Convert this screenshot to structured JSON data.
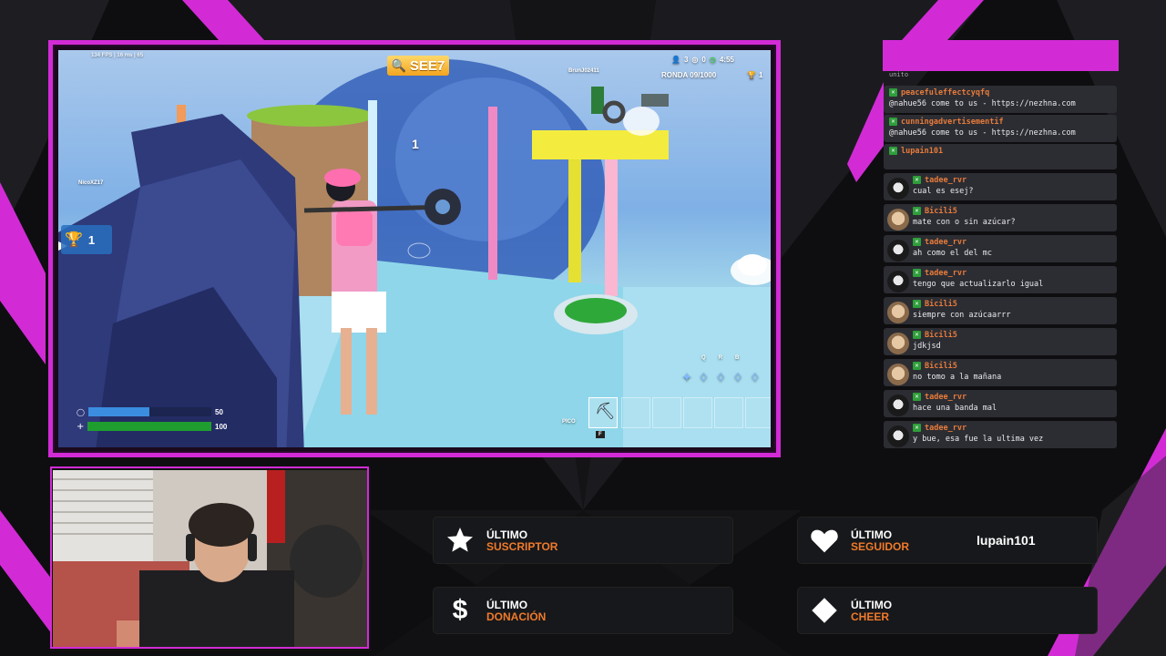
{
  "theme": {
    "accent": "#d22bd6",
    "label_accent": "#f07a2a",
    "panel_bg": "#17181b"
  },
  "game": {
    "hud_topleft": "134 FPS  |  16 ms  |  65",
    "player_search": "SEE7",
    "team_count": "3",
    "elims": "0",
    "timer": "4:55",
    "round_label": "RONDA 09/1000",
    "players_left": "1",
    "opponent_name": "BrunJ02411",
    "enemy_name": "NicoXZ17",
    "floating_number": "1",
    "trophy_count": "1",
    "shield_value": "50",
    "health_value": "100",
    "shield_pct": 0.5,
    "health_pct": 1.0,
    "weapon_label": "PICO",
    "weapon_key": "F",
    "build_keys": [
      "Q",
      "R",
      "B"
    ]
  },
  "chat": {
    "partial_top": "unito",
    "messages": [
      {
        "user": "peacefuleffectcyqfq",
        "text": "@nahue56 come to us - https://nezhna.com",
        "avatar": false
      },
      {
        "user": "cunningadvertisementif",
        "text": "@nahue56 come to us - https://nezhna.com",
        "avatar": false
      },
      {
        "user": "lupain101",
        "text": "",
        "avatar": false
      },
      {
        "user": "tadee_rvr",
        "text": "cual es esej?",
        "avatar": "dark"
      },
      {
        "user": "Bicili5",
        "text": "mate con o sin azúcar?",
        "avatar": "dog"
      },
      {
        "user": "tadee_rvr",
        "text": "ah como el del mc",
        "avatar": "dark"
      },
      {
        "user": "tadee_rvr",
        "text": "tengo que actualizarlo igual",
        "avatar": "dark"
      },
      {
        "user": "Bicili5",
        "text": "siempre con azúcaarrr",
        "avatar": "dog"
      },
      {
        "user": "Bicili5",
        "text": "jdkjsd",
        "avatar": "dog"
      },
      {
        "user": "Bicili5",
        "text": "no tomo a la mañana",
        "avatar": "dog"
      },
      {
        "user": "tadee_rvr",
        "text": "hace una banda mal",
        "avatar": "dark"
      },
      {
        "user": "tadee_rvr",
        "text": "y bue, esa fue la ultima vez",
        "avatar": "dark"
      }
    ]
  },
  "alerts": {
    "subscriber": {
      "title": "ÚLTIMO",
      "sub": "SUSCRIPTOR",
      "value": "",
      "icon": "star-icon"
    },
    "follower": {
      "title": "ÚLTIMO",
      "sub": "SEGUIDOR",
      "value": "lupain101",
      "icon": "heart-icon"
    },
    "donation": {
      "title": "ÚLTIMO",
      "sub": "DONACIÓN",
      "value": "",
      "icon": "dollar-icon"
    },
    "cheer": {
      "title": "ÚLTIMO",
      "sub": "CHEER",
      "value": "",
      "icon": "diamond-icon"
    }
  }
}
